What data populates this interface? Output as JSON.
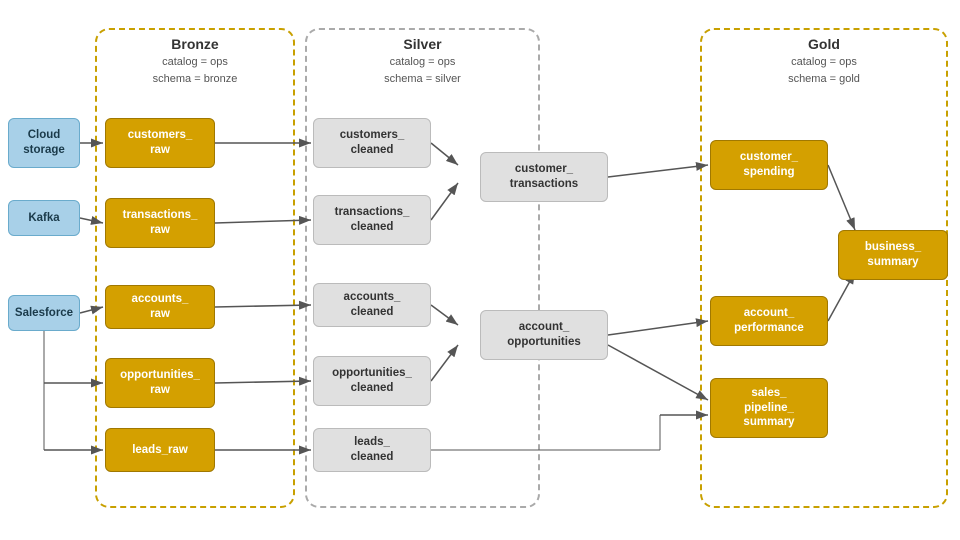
{
  "zones": [
    {
      "id": "bronze",
      "label": "Bronze",
      "sub": "catalog = ops\nschema = bronze",
      "border": "#c8a000"
    },
    {
      "id": "silver",
      "label": "Silver",
      "sub": "catalog = ops\nschema = silver",
      "border": "#aaa"
    },
    {
      "id": "gold",
      "label": "Gold",
      "sub": "catalog = ops\nschema = gold",
      "border": "#c8a000"
    }
  ],
  "nodes": {
    "cloud_storage": {
      "label": "Cloud\nstorage",
      "type": "source"
    },
    "kafka": {
      "label": "Kafka",
      "type": "source"
    },
    "salesforce": {
      "label": "Salesforce",
      "type": "source"
    },
    "customers_raw": {
      "label": "customers_\nraw",
      "type": "bronze"
    },
    "transactions_raw": {
      "label": "transactions_\nraw",
      "type": "bronze"
    },
    "accounts_raw": {
      "label": "accounts_\nraw",
      "type": "bronze"
    },
    "opportunities_raw": {
      "label": "opportunities_\nraw",
      "type": "bronze"
    },
    "leads_raw": {
      "label": "leads_raw",
      "type": "bronze"
    },
    "customers_cleaned": {
      "label": "customers_\ncleaned",
      "type": "silver"
    },
    "transactions_cleaned": {
      "label": "transactions_\ncleaned",
      "type": "silver"
    },
    "accounts_cleaned": {
      "label": "accounts_\ncleaned",
      "type": "silver"
    },
    "opportunities_cleaned": {
      "label": "opportunities_\ncleaned",
      "type": "silver"
    },
    "leads_cleaned": {
      "label": "leads_\ncleaned",
      "type": "silver"
    },
    "customer_transactions": {
      "label": "customer_\ntransactions",
      "type": "silver"
    },
    "account_opportunities": {
      "label": "account_\nopportunities",
      "type": "silver"
    },
    "customer_spending": {
      "label": "customer_\nspending",
      "type": "gold"
    },
    "account_performance": {
      "label": "account_\nperformance",
      "type": "gold"
    },
    "sales_pipeline_summary": {
      "label": "sales_\npipeline_\nsummary",
      "type": "gold"
    },
    "business_summary": {
      "label": "business_\nsummary",
      "type": "gold"
    }
  }
}
